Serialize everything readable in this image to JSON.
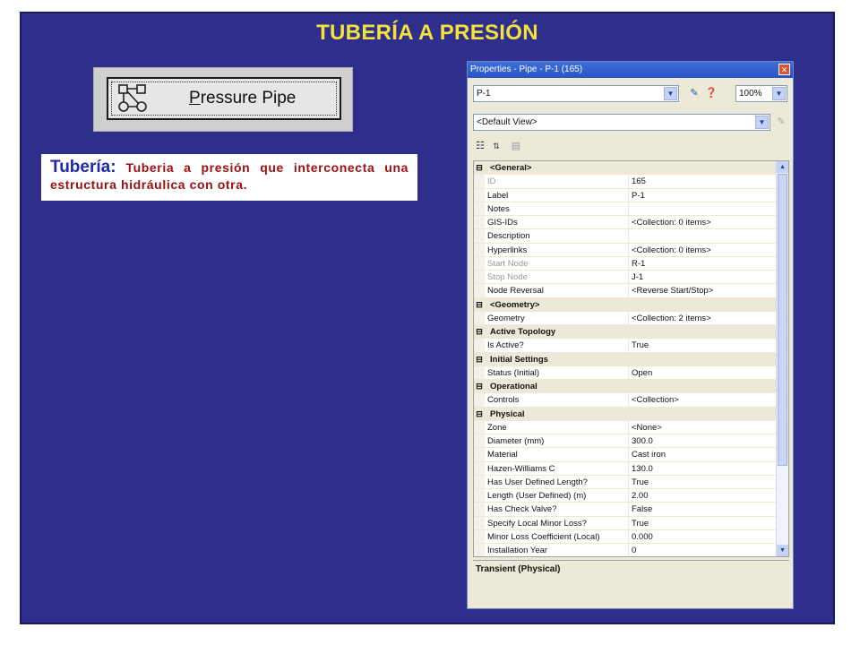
{
  "slide": {
    "title": "TUBERÍA A PRESIÓN",
    "button_label_first": "P",
    "button_label_rest": "ressure Pipe",
    "desc_term": "Tubería:",
    "desc_text": " Tuberia a presión que interconecta una estructura hidráulica con otra."
  },
  "window": {
    "title": "Properties - Pipe - P-1 (165)",
    "element_select": "P-1",
    "zoom": "100%",
    "view_select": "<Default View>",
    "help_text": "Transient (Physical)",
    "categories": [
      {
        "name": "<General>",
        "rows": [
          {
            "k": "ID",
            "v": "165",
            "dim": true
          },
          {
            "k": "Label",
            "v": "P-1"
          },
          {
            "k": "Notes",
            "v": ""
          },
          {
            "k": "GIS-IDs",
            "v": "<Collection: 0 items>"
          },
          {
            "k": "Description",
            "v": ""
          },
          {
            "k": "Hyperlinks",
            "v": "<Collection: 0 items>"
          },
          {
            "k": "Start Node",
            "v": "R-1",
            "dim": true
          },
          {
            "k": "Stop Node",
            "v": "J-1",
            "dim": true
          },
          {
            "k": "Node Reversal",
            "v": "<Reverse Start/Stop>"
          }
        ]
      },
      {
        "name": "<Geometry>",
        "rows": [
          {
            "k": "Geometry",
            "v": "<Collection: 2 items>"
          }
        ]
      },
      {
        "name": "Active Topology",
        "rows": [
          {
            "k": "Is Active?",
            "v": "True"
          }
        ]
      },
      {
        "name": "Initial Settings",
        "rows": [
          {
            "k": "Status (Initial)",
            "v": "Open"
          }
        ]
      },
      {
        "name": "Operational",
        "rows": [
          {
            "k": "Controls",
            "v": "<Collection>"
          }
        ]
      },
      {
        "name": "Physical",
        "rows": [
          {
            "k": "Zone",
            "v": "<None>"
          },
          {
            "k": "Diameter (mm)",
            "v": "300.0"
          },
          {
            "k": "Material",
            "v": "Cast iron"
          },
          {
            "k": "Hazen-Williams C",
            "v": "130.0"
          },
          {
            "k": "Has User Defined Length?",
            "v": "True"
          },
          {
            "k": "Length (User Defined) (m)",
            "v": "2.00"
          },
          {
            "k": "Has Check Valve?",
            "v": "False"
          },
          {
            "k": "Specify Local Minor Loss?",
            "v": "True"
          },
          {
            "k": "Minor Loss Coefficient (Local)",
            "v": "0.000"
          },
          {
            "k": "Installation Year",
            "v": "0"
          }
        ]
      }
    ]
  }
}
